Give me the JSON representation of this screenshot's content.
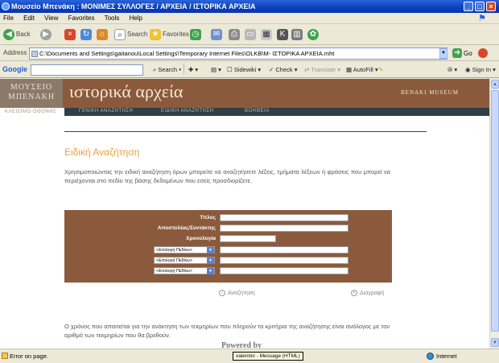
{
  "window": {
    "title": "Μουσείο Μπενάκη : ΜΟΝΙΜΕΣ ΣΥΛΛΟΓΕΣ / ΑΡΧΕΙΑ / ΙΣΤΟΡΙΚΑ ΑΡΧΕΙΑ"
  },
  "menu": [
    "File",
    "Edit",
    "View",
    "Favorites",
    "Tools",
    "Help"
  ],
  "toolbar": {
    "back": "Back",
    "search": "Search",
    "favorites": "Favorites"
  },
  "address": {
    "label": "Address",
    "url": "C:\\Documents and Settings\\gaitanou\\Local Settings\\Temporary Internet Files\\OLKB\\Μ- ΙΣΤΟΡΙΚΑ ΑΡΧΕΙΑ.mht",
    "go": "Go"
  },
  "google": {
    "logo": "Google",
    "search": "Search",
    "sidewiki": "Sidewiki",
    "check": "Check",
    "translate": "Translate",
    "autofill": "AutoFill",
    "signin": "Sign In"
  },
  "site": {
    "logo_line1": "ΜΟΥΣΕΙΟ",
    "logo_line2": "ΜΠΕΝΑΚΗ",
    "title": "ιστορικά αρχεία",
    "museum": "BENAKI MUSEUM",
    "close": "ΚΛΕΙΣΙΜΟ ΟΘΟΝΗΣ",
    "nav": [
      "ΓΕΝΙΚΗ ΑΝΑΖΗΤΗΣΗ",
      "ΕΙΔΙΚΗ ΑΝΑΖΗΤΗΣΗ",
      "ΒΟΗΘΕΙΑ"
    ]
  },
  "content": {
    "heading": "Ειδική Αναζήτηση",
    "intro": "Χρησιμοποιώντας την ειδική αναζήτηση όρων μπορείτε να αναζητήσετε λέξεις, τμήματα λέξεων ή φράσεις που μπορεί να περιέχονται στο πεδίο της βάσης δεδομένων που εσείς προσδιορίζετε.",
    "form": {
      "title_label": "Τίτλος",
      "sender_label": "Αποστολέας/Συντάκτης",
      "date_label": "Χρονολογία",
      "field_select": "<Επιλογή Πεδίου>"
    },
    "search_button": "Αναζήτηση",
    "clear_button": "Διαγραφή",
    "footnote": "Ο χρόνος που απαιτείται για την ανάκτηση των τεκμηρίων που πληρούν τα κριτήρια της αναζήτησης είναι ανάλογος με τον αριθμό των τεκμηρίων που θα βρεθούν.",
    "powered": "Powered by"
  },
  "status": {
    "text": "Error on page.",
    "tooltip": "valentini - Message (HTML)",
    "zone": "Internet"
  }
}
